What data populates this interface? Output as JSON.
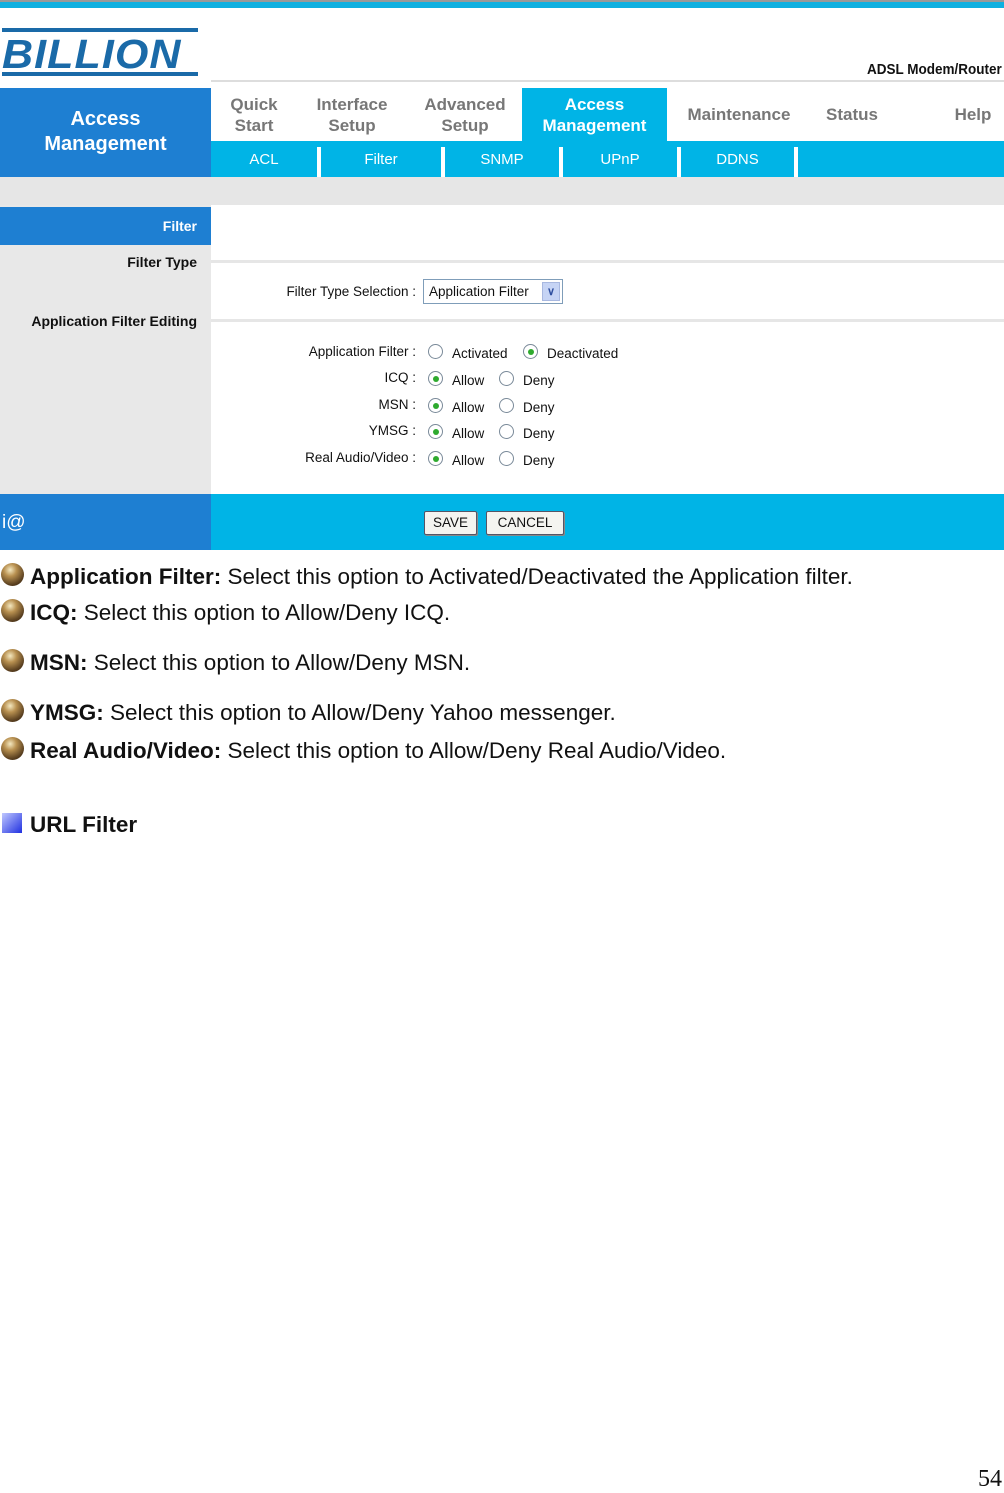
{
  "router": {
    "logo": "BILLION",
    "product": "ADSL Modem/Router",
    "section_title": [
      "Access",
      "Management"
    ],
    "tabs": [
      [
        "Quick",
        "Start"
      ],
      [
        "Interface",
        "Setup"
      ],
      [
        "Advanced",
        "Setup"
      ],
      [
        "Access",
        "Management"
      ],
      [
        "Maintenance"
      ],
      [
        "Status"
      ],
      [
        "Help"
      ]
    ],
    "active_tab": "Access Management",
    "subtabs": [
      "ACL",
      "Filter",
      "SNMP",
      "UPnP",
      "DDNS"
    ],
    "sidebar": {
      "header": "Filter",
      "items": [
        "Filter Type",
        "Application Filter Editing"
      ]
    },
    "filter_type_label": "Filter Type Selection :",
    "filter_type_value": "Application Filter",
    "app_filter": {
      "label": "Application Filter :",
      "options": [
        "Activated",
        "Deactivated"
      ],
      "selected": "Deactivated"
    },
    "rows": [
      {
        "label": "ICQ :",
        "options": [
          "Allow",
          "Deny"
        ],
        "selected": "Allow"
      },
      {
        "label": "MSN :",
        "options": [
          "Allow",
          "Deny"
        ],
        "selected": "Allow"
      },
      {
        "label": "YMSG :",
        "options": [
          "Allow",
          "Deny"
        ],
        "selected": "Allow"
      },
      {
        "label": "Real Audio/Video :",
        "options": [
          "Allow",
          "Deny"
        ],
        "selected": "Allow"
      }
    ],
    "footer_mark": "i@",
    "save": "SAVE",
    "cancel": "CANCEL",
    "colors": {
      "blue": "#1e7fd2",
      "cyan": "#00b4e6"
    }
  },
  "doc": {
    "bullets": [
      {
        "term": "Application Filter:",
        "text": " Select this option to Activated/Deactivated the Application filter."
      },
      {
        "term": "ICQ:",
        "text": " Select this option to Allow/Deny ICQ."
      },
      {
        "term": "MSN:",
        "text": " Select this option to Allow/Deny MSN."
      },
      {
        "term": "YMSG:",
        "text": " Select this option to Allow/Deny Yahoo messenger."
      },
      {
        "term": "Real Audio/Video:",
        "text": " Select this option to Allow/Deny Real Audio/Video."
      }
    ],
    "heading": "URL Filter",
    "page_number": "54"
  }
}
